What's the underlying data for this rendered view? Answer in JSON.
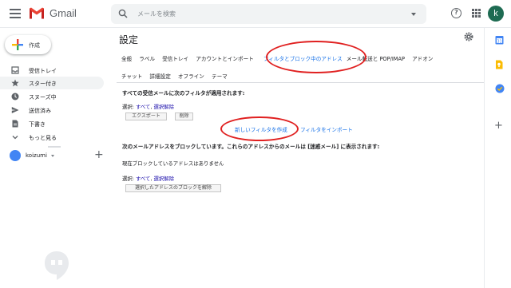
{
  "header": {
    "app_name": "Gmail",
    "search_placeholder": "メールを検索",
    "help_symbol": "?",
    "avatar_letter": "k"
  },
  "compose": {
    "label": "作成"
  },
  "sidebar": {
    "items": [
      {
        "label": "受信トレイ",
        "icon": "inbox-icon"
      },
      {
        "label": "スター付き",
        "icon": "star-icon"
      },
      {
        "label": "スヌーズ中",
        "icon": "clock-icon"
      },
      {
        "label": "送信済み",
        "icon": "send-icon"
      },
      {
        "label": "下書き",
        "icon": "draft-icon"
      },
      {
        "label": "もっと見る",
        "icon": "chevron-down-icon"
      }
    ],
    "active_index": 1,
    "user_name": "koizumi",
    "add_symbol": "+"
  },
  "settings": {
    "title": "設定",
    "tabs_row1": [
      "全般",
      "ラベル",
      "受信トレイ",
      "アカウントとインポート",
      "フィルタとブロック中のアドレス",
      "メール転送と POP/IMAP",
      "アドオン"
    ],
    "tabs_row2": [
      "チャット",
      "詳細設定",
      "オフライン",
      "テーマ"
    ],
    "active_tab_index": 4
  },
  "filters": {
    "heading": "すべての受信メールに次のフィルタが適用されます:",
    "select_label": "選択: ",
    "select_all": "すべて",
    "select_none": "選択解除",
    "export_button": "エクスポート",
    "delete_button": "削除",
    "create_filter_link": "新しいフィルタを作成",
    "import_filter_link": "フィルタをインポート"
  },
  "blocked": {
    "heading": "次のメールアドレスをブロックしています。これらのアドレスからのメールは [迷惑メール] に表示されます:",
    "none_text": "現在ブロックしているアドレスはありません",
    "select_label": "選択: ",
    "select_all": "すべて",
    "select_none": "選択解除",
    "unblock_button": "選択したアドレスのブロックを解除"
  },
  "colors": {
    "accent": "#1a73e8",
    "annotation_red": "#e02020",
    "avatar_bg": "#1e6b52"
  }
}
